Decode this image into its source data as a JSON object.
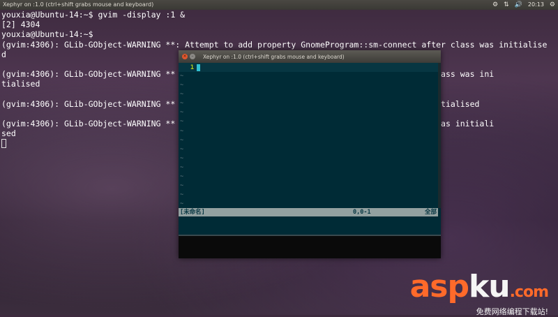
{
  "top_panel": {
    "window_title": "Xephyr on :1.0 (ctrl+shift grabs mouse and keyboard)",
    "time": "20:13",
    "icons": [
      "volume-icon-status",
      "network-icon",
      "volume-icon",
      "gear-icon"
    ]
  },
  "terminal": {
    "lines": [
      "youxia@Ubuntu-14:~$ gvim -display :1 &",
      "[2] 4304",
      "youxia@Ubuntu-14:~$",
      "(gvim:4306): GLib-GObject-WARNING **: Attempt to add property GnomeProgram::sm-connect after class was initialise",
      "d",
      "",
      "(gvim:4306): GLib-GObject-WARNING **                                          alog after class was ini",
      "tialised",
      "",
      "(gvim:4306): GLib-GObject-WARNING **                                          class was initialised",
      "",
      "(gvim:4306): GLib-GObject-WARNING **                                          after class was initiali",
      "sed"
    ]
  },
  "xephyr": {
    "title": "Xephyr on :1.0 (ctrl+shift grabs mouse and keyboard)",
    "close_glyph": "×",
    "min_glyph": "–"
  },
  "vim": {
    "line_number": "1",
    "tilde": "~",
    "tilde_count": 15,
    "status_name": "[未命名]",
    "status_pos": "0,0-1",
    "status_pct": "全部"
  },
  "watermark": {
    "logo_a": "asp",
    "logo_b": "ku",
    "logo_c": ".com",
    "subtitle": "免费网络编程下载站!"
  }
}
